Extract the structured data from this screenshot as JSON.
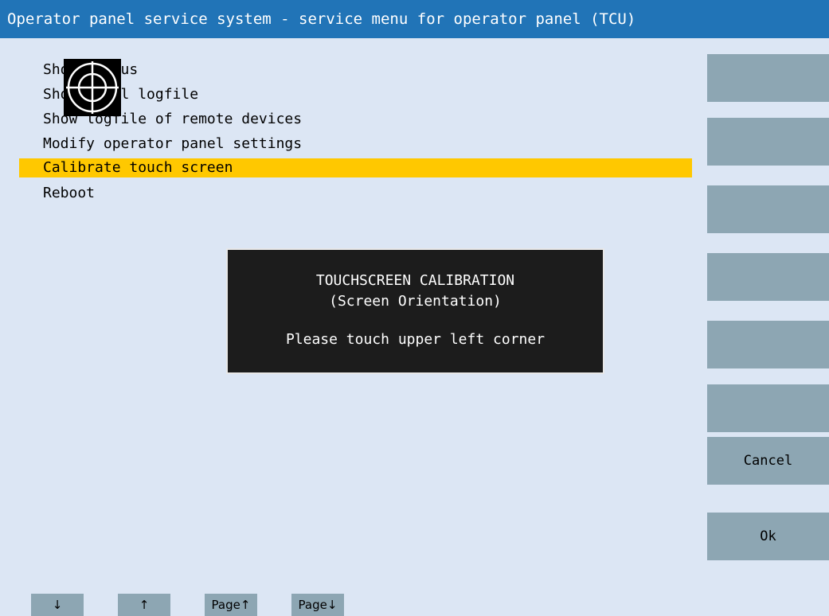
{
  "titlebar": {
    "title": "Operator panel service system - service menu for operator panel (TCU)"
  },
  "menu": {
    "items": [
      {
        "label": "Show status"
      },
      {
        "label": "Show local logfile"
      },
      {
        "label": "Show logfile of remote devices"
      },
      {
        "label": "Modify operator panel settings"
      },
      {
        "label": "Calibrate touch screen",
        "selected": true
      },
      {
        "label": "Reboot"
      }
    ]
  },
  "dialog": {
    "title": "TOUCHSCREEN CALIBRATION",
    "subtitle": "(Screen Orientation)",
    "message": "Please touch upper left corner"
  },
  "softkeys": {
    "cancel_label": "Cancel",
    "ok_label": "Ok"
  },
  "bottom_keys": {
    "down_label": "↓",
    "up_label": "↑",
    "page_up_label": "Page↑",
    "page_down_label": "Page↓"
  },
  "colors": {
    "background": "#dce6f4",
    "titlebar": "#2174b7",
    "selection": "#ffc800",
    "softkey": "#8da6b3",
    "dialog": "#1c1c1c"
  }
}
